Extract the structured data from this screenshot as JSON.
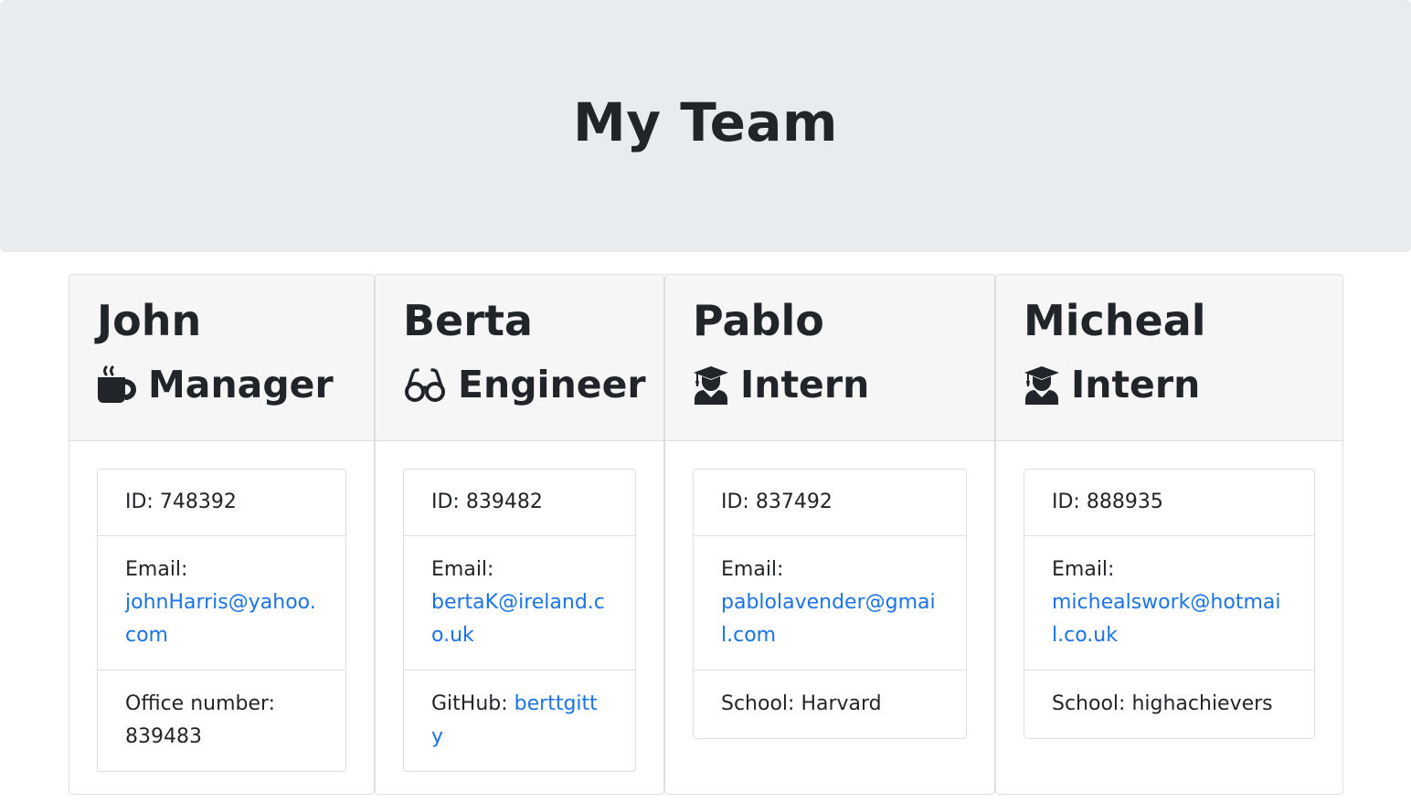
{
  "header": {
    "title": "My Team"
  },
  "team": [
    {
      "name": "John",
      "role": "Manager",
      "icon": "mug-icon",
      "id_label": "ID: 748392",
      "email_label": "Email:",
      "email": "johnHarris@yahoo.com",
      "extra_label": "Office number:",
      "extra_value": "839483"
    },
    {
      "name": "Berta",
      "role": "Engineer",
      "icon": "glasses-icon",
      "id_label": "ID: 839482",
      "email_label": "Email:",
      "email": "bertaK@ireland.co.uk",
      "extra_label": "GitHub:",
      "extra_value": "berttgitty"
    },
    {
      "name": "Pablo",
      "role": "Intern",
      "icon": "graduate-icon",
      "id_label": "ID: 837492",
      "email_label": "Email:",
      "email": "pablolavender@gmail.com",
      "extra_label": "School:",
      "extra_value": "Harvard"
    },
    {
      "name": "Micheal",
      "role": "Intern",
      "icon": "graduate-icon",
      "id_label": "ID: 888935",
      "email_label": "Email:",
      "email": "michealswork@hotmail.co.uk",
      "extra_label": "School:",
      "extra_value": "highachievers"
    }
  ],
  "colors": {
    "link": "#1a73e8",
    "header_bg": "#e9ecef",
    "card_header_bg": "#f6f6f6"
  }
}
